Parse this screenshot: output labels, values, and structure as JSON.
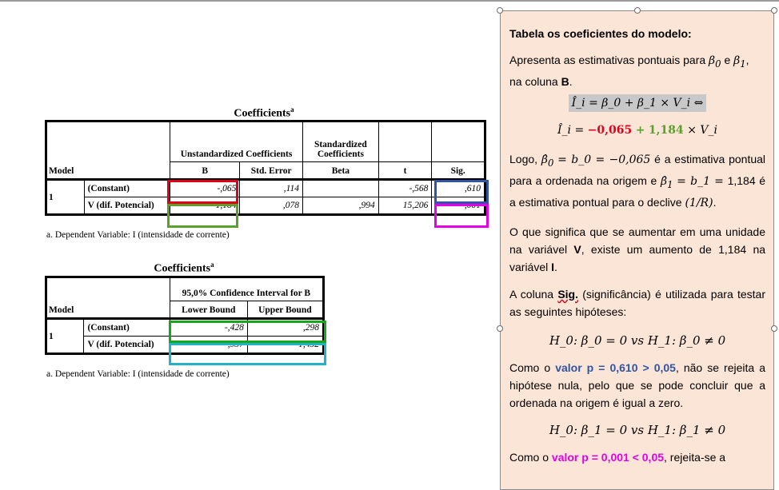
{
  "table1": {
    "title": "Coefficients",
    "title_sup": "a",
    "header": {
      "unstd": "Unstandardized Coefficients",
      "std": "Standardized Coefficients",
      "model": "Model",
      "b": "B",
      "se": "Std. Error",
      "beta": "Beta",
      "t": "t",
      "sig": "Sig."
    },
    "model_num": "1",
    "rows": [
      {
        "label": "(Constant)",
        "b": "-,065",
        "se": ",114",
        "beta": "",
        "t": "-,568",
        "sig": ",610"
      },
      {
        "label": "V (dif. Potencial)",
        "b": "1,184",
        "se": ",078",
        "beta": ",994",
        "t": "15,206",
        "sig": ",001"
      }
    ],
    "footnote": "a. Dependent Variable: I (intensidade de corrente)"
  },
  "table2": {
    "title": "Coefficients",
    "title_sup": "a",
    "header": {
      "ci": "95,0% Confidence Interval for B",
      "model": "Model",
      "lower": "Lower Bound",
      "upper": "Upper Bound"
    },
    "model_num": "1",
    "rows": [
      {
        "label": "(Constant)",
        "lower": "-,428",
        "upper": ",298"
      },
      {
        "label": "V (dif. Potencial)",
        "lower": ",937",
        "upper": "1,432"
      }
    ],
    "footnote": "a. Dependent Variable: I (intensidade de corrente)"
  },
  "highlight_colors": {
    "b_constant": "#e0001a",
    "b_v": "#5aa02c",
    "sig_constant": "#2f55a4",
    "sig_v": "#e600e6",
    "ci_constant": "#19a619",
    "ci_v": "#1fb2c8"
  },
  "panel": {
    "heading": "Tabela os coeficientes do modelo:",
    "p1_a": "Apresenta as estimativas pontuais para",
    "p1_b": "e",
    "p1_c": ",",
    "p1_d": "na coluna",
    "p1_e": "B",
    "p1_f": ".",
    "eq_model": "Î_i = β_0 + β_1 × V_i ⇔",
    "eq_fit_lhs": "Î_i =",
    "eq_fit_b0": "−0,065",
    "eq_fit_plus": "+",
    "eq_fit_b1": "1,184",
    "eq_fit_rhs": "× V_i",
    "p2_a": "Logo,",
    "p2_b": "= b_0 = −0,065",
    "p2_c": "é a estimativa pontual para a ordenada na origem e",
    "p2_d": "= b_1 =",
    "p2_e": "1,184 é a estimativa pontual para o declive",
    "p2_f": ".",
    "p3_a": "O que significa que se aumentar em uma unidade na variável",
    "p3_v": "V",
    "p3_b": ", existe um aumento de 1,184 na variável",
    "p3_i": "I",
    "p3_c": ".",
    "p4_a": "A coluna",
    "p4_sig": "Sig.",
    "p4_b": "(significância) é utilizada para testar as seguintes hipóteses:",
    "h0_1": "H_0: β_0 = 0 vs H_1: β_0 ≠ 0",
    "p5_a": "Como o",
    "p5_val": "valor p = 0,610 > 0,05",
    "p5_b": ", não se rejeita a hipótese nula, pelo que se pode concluir que a ordenada na origem é igual a zero.",
    "h0_2": "H_0: β_1 = 0 vs H_1: β_1 ≠ 0",
    "p6_a": "Como o",
    "p6_val": "valor p = 0,001 < 0,05",
    "p6_b": ", rejeita-se a"
  }
}
